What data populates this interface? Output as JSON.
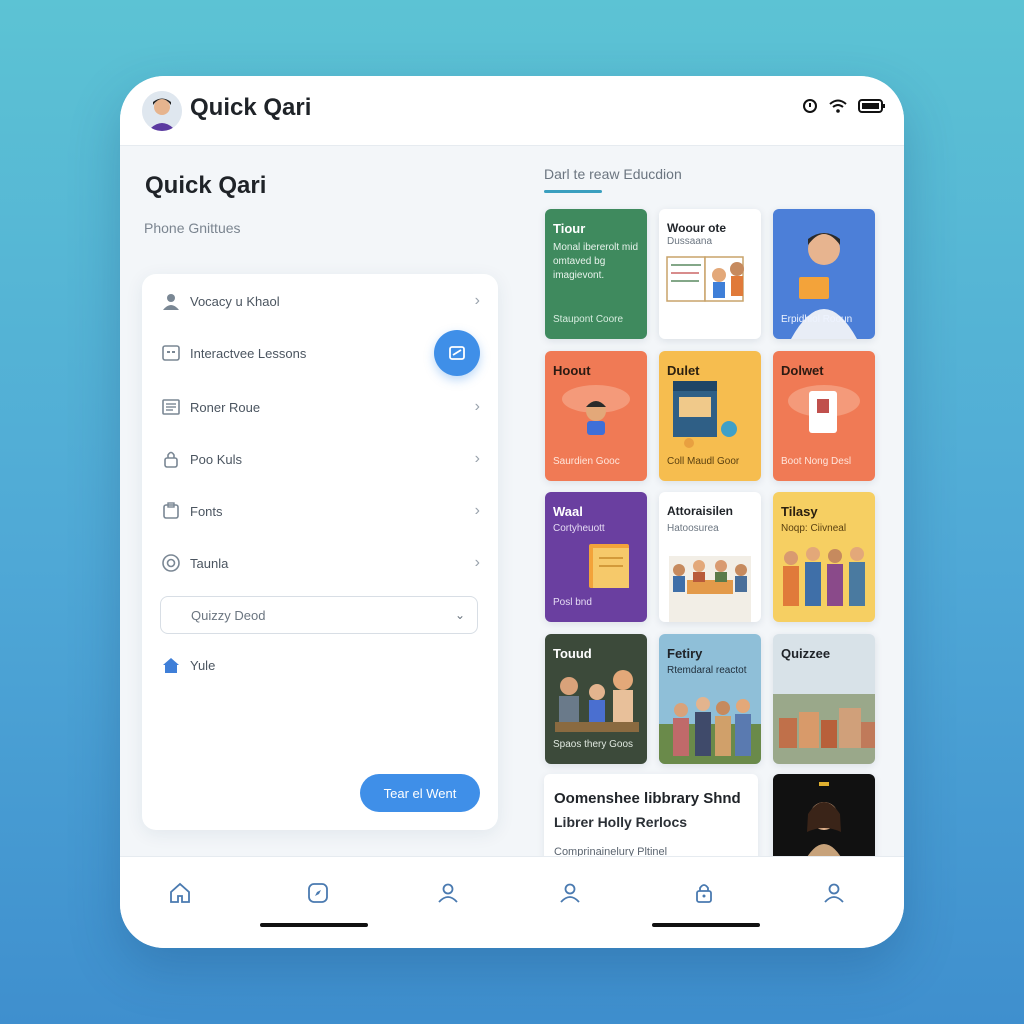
{
  "app": {
    "title": "Quick Qari"
  },
  "main": {
    "title": "Quick Qari",
    "subtitle": "Phone Gnittues"
  },
  "menu": {
    "items": [
      {
        "label": "Vocacy u Khaol",
        "icon": "user-icon"
      },
      {
        "label": "Interactvee Lessons",
        "icon": "lesson-icon"
      },
      {
        "label": "Roner Roue",
        "icon": "document-icon"
      },
      {
        "label": "Poo Kuls",
        "icon": "lock-icon"
      },
      {
        "label": "Fonts",
        "icon": "folder-icon"
      },
      {
        "label": "Taunla",
        "icon": "target-icon"
      }
    ],
    "select_value": "Quizzy Deod",
    "home_label": "Yule",
    "cta_label": "Tear el Went"
  },
  "section": {
    "title": "Darl te reaw Educdion"
  },
  "tiles": [
    {
      "title": "Tiour",
      "sub": "Monal ibererolt mid omtaved bg imagievont.",
      "foot": "Staupont Coore",
      "bg": "#3f8a5e"
    },
    {
      "title": "Woour ote",
      "sub": "Dussaana",
      "foot": "",
      "bg": "#ffffff"
    },
    {
      "title": "",
      "sub": "",
      "foot": "Erpidhiol Rooun",
      "bg": "#4c7fd8"
    },
    {
      "title": "Hoout",
      "sub": "",
      "foot": "Saurdien Gooc",
      "bg": "#f07a55"
    },
    {
      "title": "Dulet",
      "sub": "",
      "foot": "Coll Maudl Goor",
      "bg": "#f6bd4f"
    },
    {
      "title": "Dolwet",
      "sub": "",
      "foot": "Boot Nong Desl",
      "bg": "#f07a55"
    },
    {
      "title": "Waal",
      "sub": "Cortyheuott",
      "foot": "Posl bnd",
      "bg": "#6a3fa0"
    },
    {
      "title": "Attoraisilen",
      "sub": "Hatoosurea",
      "foot": "",
      "bg": "#ffffff"
    },
    {
      "title": "Tilasy",
      "sub": "Noqp: Ciivneal",
      "foot": "",
      "bg": "#f6cf62"
    },
    {
      "title": "Touud",
      "sub": "",
      "foot": "Spaos thery Goos",
      "bg": "#3c4a3a"
    },
    {
      "title": "Fetiry",
      "sub": "Rtemdaral reactot",
      "foot": "",
      "bg": "#8fbfd8"
    },
    {
      "title": "Quizzee",
      "sub": "",
      "foot": "",
      "bg": "#d8e2e8"
    }
  ],
  "wide_card": {
    "line1": "Oomenshee libbrary Shnd",
    "line2": "Librer Holly Rerlocs",
    "line3": "Comprinainelury Pltinel"
  },
  "bottom_nav": [
    "home-icon",
    "compass-icon",
    "profile-icon",
    "account-icon",
    "lock-icon",
    "person-icon"
  ],
  "colors": {
    "accent": "#3f8fe8",
    "teal": "#3a9fbf"
  }
}
